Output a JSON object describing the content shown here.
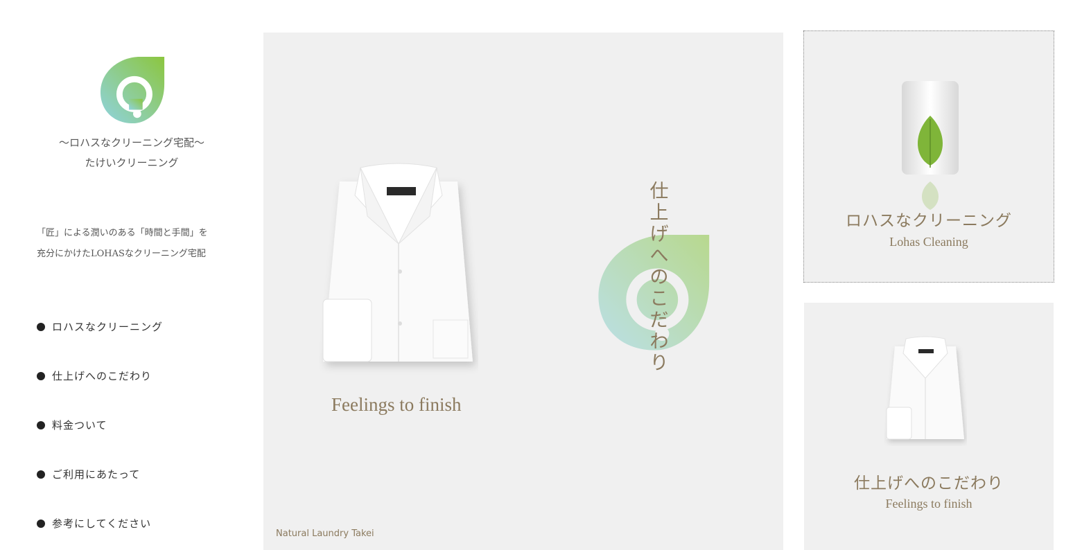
{
  "sidebar": {
    "tagline_line1": "〜ロハスなクリーニング宅配〜",
    "tagline_line2": "たけいクリーニング",
    "intro_line1": "「匠」による潤いのある「時間と手間」を",
    "intro_line2": "充分にかけたLOHASなクリーニング宅配",
    "nav": [
      {
        "label": "ロハスなクリーニング"
      },
      {
        "label": "仕上げへのこだわり"
      },
      {
        "label": "料金ついて"
      },
      {
        "label": "ご利用にあたって"
      },
      {
        "label": "参考にしてください"
      }
    ]
  },
  "hero": {
    "caption": "Feelings to finish",
    "vertical_title": [
      "仕",
      "上",
      "げ",
      "へ",
      "の",
      "こ",
      "だ",
      "わ",
      "り"
    ],
    "brand": "Natural Laundry Takei"
  },
  "cards": [
    {
      "title": "ロハスなクリーニング",
      "subtitle": "Lohas Cleaning"
    },
    {
      "title": "仕上げへのこだわり",
      "subtitle": "Feelings to finish"
    }
  ],
  "colors": {
    "accent_text": "#8b7a5e",
    "panel_bg": "#f0f0f0",
    "logo_green": "#8cc63f",
    "logo_blue": "#8fd3e0"
  }
}
